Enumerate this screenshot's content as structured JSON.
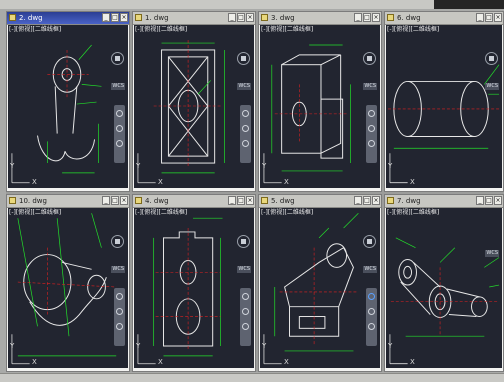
{
  "windows": [
    {
      "title": "2. dwg",
      "view_label": "[-][俯视][二维线框]",
      "active": true
    },
    {
      "title": "1. dwg",
      "view_label": "[-][俯视][二维线框]",
      "active": false
    },
    {
      "title": "3. dwg",
      "view_label": "[-][俯视][二维线框]",
      "active": false
    },
    {
      "title": "6. dwg",
      "view_label": "[-][俯视][二维线框]",
      "active": false
    },
    {
      "title": "10. dwg",
      "view_label": "[-][俯视][二维线框]",
      "active": false
    },
    {
      "title": "4. dwg",
      "view_label": "[-][俯视][二维线框]",
      "active": false
    },
    {
      "title": "5. dwg",
      "view_label": "[-][俯视][二维线框]",
      "active": false
    },
    {
      "title": "7. dwg",
      "view_label": "[-][俯视][二维线框]",
      "active": false
    }
  ],
  "wcs_label": "WCS",
  "axis_x": "X",
  "axis_y": "Y",
  "buttons": {
    "minimize": "_",
    "restore": "□",
    "close": "×"
  },
  "icons": {
    "file": "dwg-file-icon",
    "viewcube": "viewcube-icon",
    "navbar": "navigation-bar-icon"
  },
  "colors": {
    "model_bg": "#222530",
    "active_title": "#2b3e93",
    "geometry": "#e8e8e8",
    "dimension": "#22e02a",
    "centerline": "#e02020"
  }
}
